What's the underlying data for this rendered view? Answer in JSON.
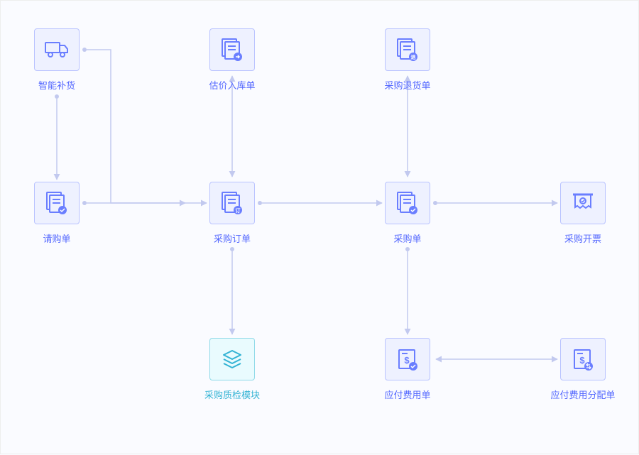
{
  "nodes": {
    "smart_restock": {
      "label": "智能补货",
      "icon": "truck"
    },
    "requisition": {
      "label": "请购单",
      "icon": "doc-check"
    },
    "estimate_inbound": {
      "label": "估价入库单",
      "icon": "doc-arrow"
    },
    "purchase_order": {
      "label": "采购订单",
      "icon": "doc-order"
    },
    "purchase_return": {
      "label": "采购退货单",
      "icon": "doc-return"
    },
    "purchase": {
      "label": "采购单",
      "icon": "doc-check"
    },
    "purchase_invoice": {
      "label": "采购开票",
      "icon": "invoice"
    },
    "quality_module": {
      "label": "采购质检模块",
      "icon": "layers",
      "alt": true
    },
    "payable": {
      "label": "应付费用单",
      "icon": "doc-money"
    },
    "payable_alloc": {
      "label": "应付费用分配单",
      "icon": "doc-alloc"
    }
  },
  "diagram": {
    "type": "flowchart",
    "edges": [
      [
        "smart_restock",
        "purchase_order"
      ],
      [
        "smart_restock",
        "requisition"
      ],
      [
        "requisition",
        "purchase_order"
      ],
      [
        "purchase_order",
        "estimate_inbound",
        "bidirectional"
      ],
      [
        "purchase_order",
        "purchase"
      ],
      [
        "purchase_order",
        "quality_module"
      ],
      [
        "purchase",
        "purchase_return",
        "bidirectional"
      ],
      [
        "purchase",
        "purchase_invoice"
      ],
      [
        "purchase",
        "payable"
      ],
      [
        "payable",
        "payable_alloc",
        "bidirectional"
      ]
    ]
  }
}
